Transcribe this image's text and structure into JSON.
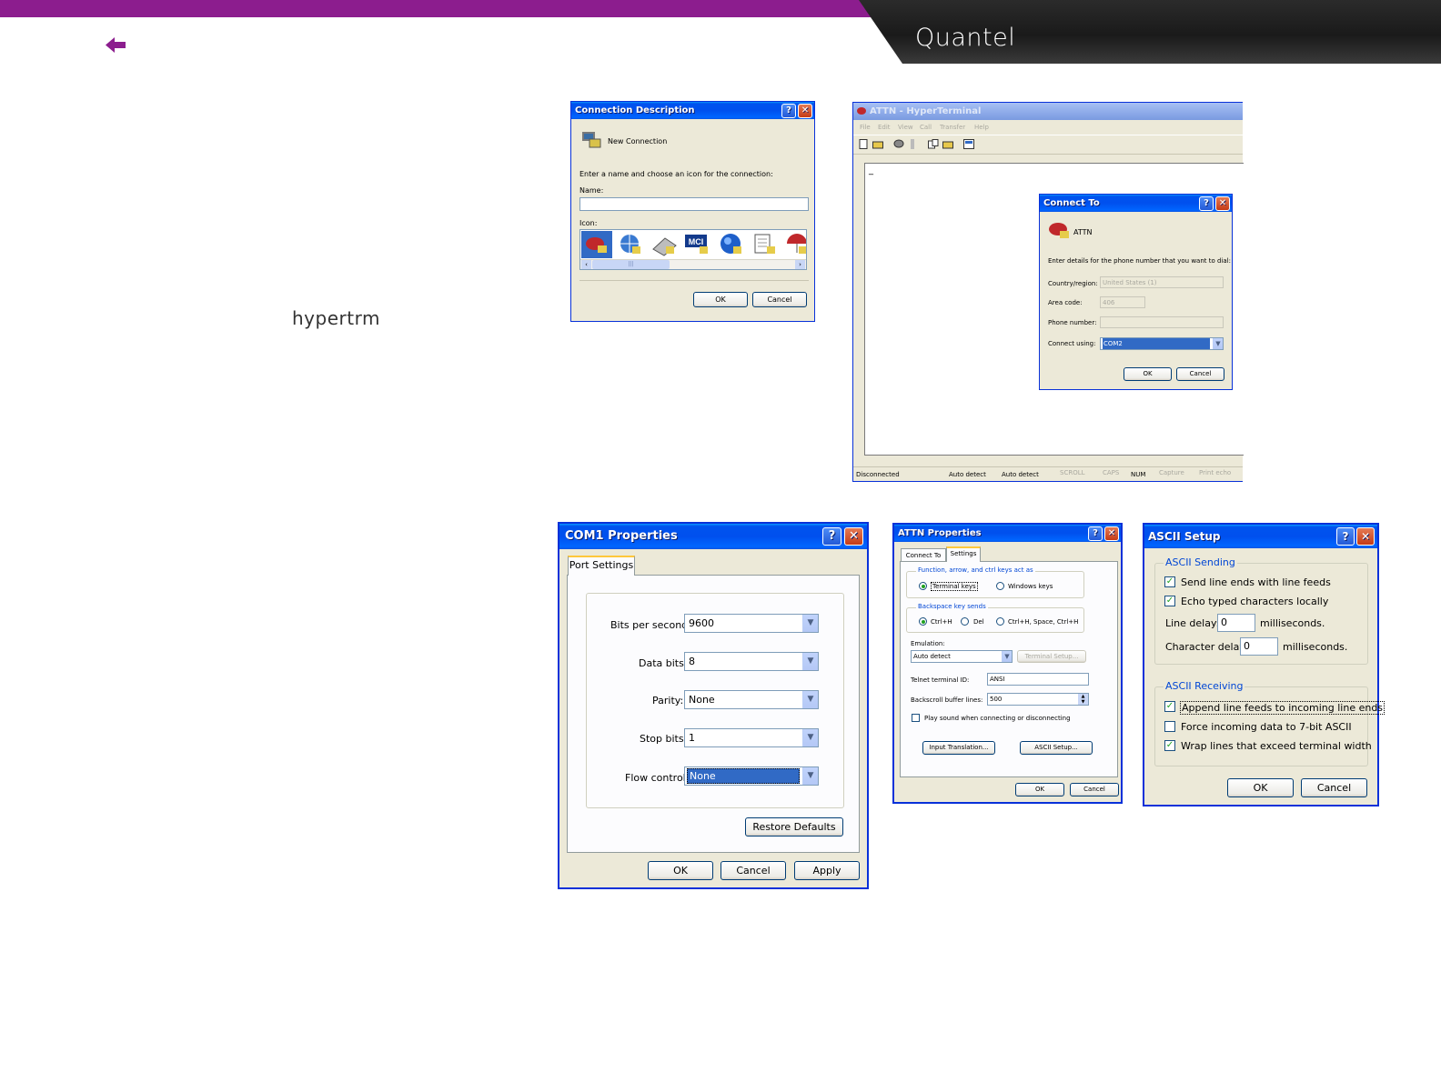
{
  "header": {
    "brand": "Quantel",
    "accent_color": "#8c1d8e",
    "back_icon": "back-arrow-icon"
  },
  "side_text": "hypertrm",
  "connection_description": {
    "title": "Connection Description",
    "header_label": "New Connection",
    "prompt": "Enter a name and choose an icon for the connection:",
    "name_label": "Name:",
    "name_value": "",
    "icon_label": "Icon:",
    "icons": [
      "phone-icon",
      "globe-phone-icon",
      "fax-icon",
      "mci-icon",
      "network-globe-icon",
      "document-icon",
      "umbrella-phone-icon"
    ],
    "mci_text": "MCI",
    "scroll_mark": "|||",
    "ok": "OK",
    "cancel": "Cancel"
  },
  "hyperterminal": {
    "title": "ATTN - HyperTerminal",
    "menu": [
      "File",
      "Edit",
      "View",
      "Call",
      "Transfer",
      "Help"
    ],
    "cursor": "_",
    "status": [
      "Disconnected",
      "Auto detect",
      "Auto detect",
      "SCROLL",
      "CAPS",
      "NUM",
      "Capture",
      "Print echo"
    ]
  },
  "connect_to": {
    "title": "Connect To",
    "name": "ATTN",
    "prompt": "Enter details for the phone number that you want to dial:",
    "country_label": "Country/region:",
    "country_value": "United States (1)",
    "area_label": "Area code:",
    "area_value": "406",
    "phone_label": "Phone number:",
    "phone_value": "",
    "connect_label": "Connect using:",
    "connect_value": "COM2",
    "ok": "OK",
    "cancel": "Cancel"
  },
  "com1": {
    "title": "COM1 Properties",
    "tab": "Port Settings",
    "bits_label": "Bits per second:",
    "bits_value": "9600",
    "data_label": "Data bits:",
    "data_value": "8",
    "parity_label": "Parity:",
    "parity_value": "None",
    "stop_label": "Stop bits:",
    "stop_value": "1",
    "flow_label": "Flow control:",
    "flow_value": "None",
    "restore": "Restore Defaults",
    "ok": "OK",
    "cancel": "Cancel",
    "apply": "Apply"
  },
  "attn_props": {
    "title": "ATTN Properties",
    "tabs": [
      "Connect To",
      "Settings"
    ],
    "fkeys_group": "Function, arrow, and ctrl keys act as",
    "terminal_keys": "Terminal keys",
    "windows_keys": "Windows keys",
    "backspace_group": "Backspace key sends",
    "ctrl_h": "Ctrl+H",
    "del": "Del",
    "ctrl_h_space": "Ctrl+H, Space, Ctrl+H",
    "emulation_label": "Emulation:",
    "emulation_value": "Auto detect",
    "terminal_setup": "Terminal Setup...",
    "telnet_label": "Telnet terminal ID:",
    "telnet_value": "ANSI",
    "backscroll_label": "Backscroll buffer lines:",
    "backscroll_value": "500",
    "play_sound": "Play sound when connecting or disconnecting",
    "input_translation": "Input Translation...",
    "ascii_setup": "ASCII Setup...",
    "ok": "OK",
    "cancel": "Cancel"
  },
  "ascii_setup": {
    "title": "ASCII Setup",
    "sending_group": "ASCII Sending",
    "send_line_ends": "Send line ends with line feeds",
    "echo_typed": "Echo typed characters locally",
    "line_delay_label": "Line delay:",
    "line_delay_value": "0",
    "char_delay_label": "Character delay:",
    "char_delay_value": "0",
    "ms": "milliseconds.",
    "receiving_group": "ASCII Receiving",
    "append_line_feeds": "Append line feeds to incoming line ends",
    "force_7bit": "Force incoming data to 7-bit ASCII",
    "wrap_lines": "Wrap lines that exceed terminal width",
    "ok": "OK",
    "cancel": "Cancel"
  }
}
